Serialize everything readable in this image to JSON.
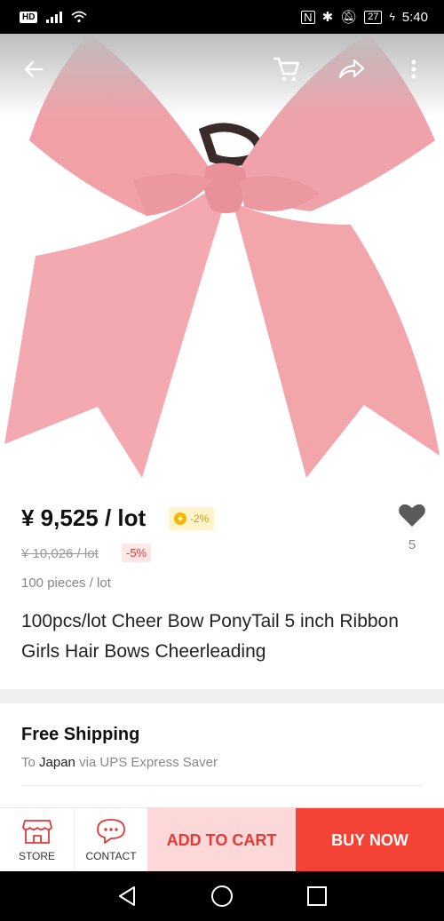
{
  "status_bar": {
    "hd": "HD",
    "battery": "27",
    "time": "5:40"
  },
  "hero": {
    "back_icon": "arrow-left-icon",
    "cart_icon": "cart-icon",
    "share_icon": "share-icon",
    "more_icon": "more-vert-icon"
  },
  "product": {
    "price": "¥ 9,525 / lot",
    "coin_discount": "-2%",
    "original_price": "¥ 10,026 / lot",
    "discount": "-5%",
    "pieces": "100 pieces / lot",
    "wishlist_count": "5",
    "title": "100pcs/lot Cheer Bow PonyTail 5 inch Ribbon Girls Hair Bows Cheerleading"
  },
  "shipping": {
    "title": "Free Shipping",
    "to_label": "To",
    "destination": "Japan",
    "via": "via UPS Express Saver"
  },
  "actions": {
    "store_label": "STORE",
    "contact_label": "CONTACT",
    "add_to_cart": "ADD TO CART",
    "buy_now": "BUY NOW"
  },
  "colors": {
    "accent": "#f44336",
    "cart_bg": "#fcd8d8",
    "bow": "#f2a0a8"
  }
}
